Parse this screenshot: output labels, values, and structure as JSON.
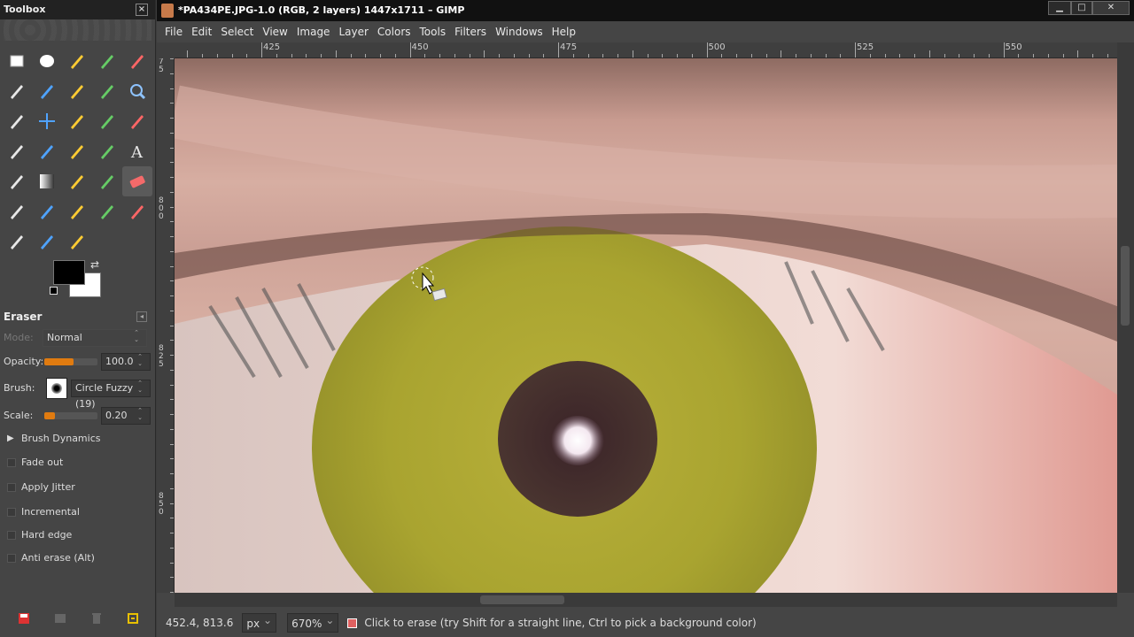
{
  "toolbox": {
    "title": "Toolbox",
    "close_glyph": "×",
    "tools": [
      {
        "name": "rect-select-icon"
      },
      {
        "name": "ellipse-select-icon"
      },
      {
        "name": "free-select-icon"
      },
      {
        "name": "fuzzy-select-icon"
      },
      {
        "name": "color-select-icon"
      },
      {
        "name": "scissors-select-icon"
      },
      {
        "name": "foreground-select-icon"
      },
      {
        "name": "paths-icon"
      },
      {
        "name": "color-picker-icon"
      },
      {
        "name": "zoom-icon"
      },
      {
        "name": "measure-icon"
      },
      {
        "name": "move-icon"
      },
      {
        "name": "align-icon"
      },
      {
        "name": "crop-icon"
      },
      {
        "name": "rotate-icon"
      },
      {
        "name": "scale-icon"
      },
      {
        "name": "shear-icon"
      },
      {
        "name": "perspective-icon"
      },
      {
        "name": "flip-icon"
      },
      {
        "name": "text-icon"
      },
      {
        "name": "bucket-fill-icon"
      },
      {
        "name": "blend-icon"
      },
      {
        "name": "pencil-icon"
      },
      {
        "name": "paintbrush-icon"
      },
      {
        "name": "eraser-icon"
      },
      {
        "name": "airbrush-icon"
      },
      {
        "name": "ink-icon"
      },
      {
        "name": "clone-icon"
      },
      {
        "name": "heal-icon"
      },
      {
        "name": "perspective-clone-icon"
      },
      {
        "name": "blur-sharpen-icon"
      },
      {
        "name": "smudge-icon"
      },
      {
        "name": "dodge-burn-icon"
      }
    ],
    "text_tool_glyph": "A",
    "active_tool_index": 24,
    "colors": {
      "foreground": "#000000",
      "background": "#ffffff"
    }
  },
  "tool_options": {
    "title": "Eraser",
    "mode_label": "Mode:",
    "mode_value": "Normal",
    "opacity_label": "Opacity:",
    "opacity_value": "100.0",
    "opacity_fraction": 1.0,
    "brush_label": "Brush:",
    "brush_value": "Circle Fuzzy (19)",
    "scale_label": "Scale:",
    "scale_value": "0.20",
    "scale_fraction": 0.2,
    "brush_dynamics_label": "Brush Dynamics",
    "checkboxes": [
      {
        "label": "Fade out"
      },
      {
        "label": "Apply Jitter"
      },
      {
        "label": "Incremental"
      },
      {
        "label": "Hard edge"
      },
      {
        "label": "Anti erase  (Alt)"
      }
    ]
  },
  "window": {
    "title": "*PA434PE.JPG-1.0 (RGB, 2 layers) 1447x1711 – GIMP",
    "minimize": "▁",
    "maximize": "□",
    "close": "✕"
  },
  "menubar": [
    "File",
    "Edit",
    "Select",
    "View",
    "Image",
    "Layer",
    "Colors",
    "Tools",
    "Filters",
    "Windows",
    "Help"
  ],
  "ruler": {
    "h_labels": [
      "425",
      "450",
      "475",
      "500",
      "525",
      "550"
    ],
    "v_labels": [
      "75",
      "800",
      "825",
      "850"
    ]
  },
  "status": {
    "coords": "452.4, 813.6",
    "unit": "px",
    "zoom": "670%",
    "message": "Click to erase (try Shift for a straight line, Ctrl to pick a background color)"
  },
  "colors": {
    "accent": "#e07b10",
    "iris": "#b8b03a",
    "pupil": "#3a2328"
  }
}
